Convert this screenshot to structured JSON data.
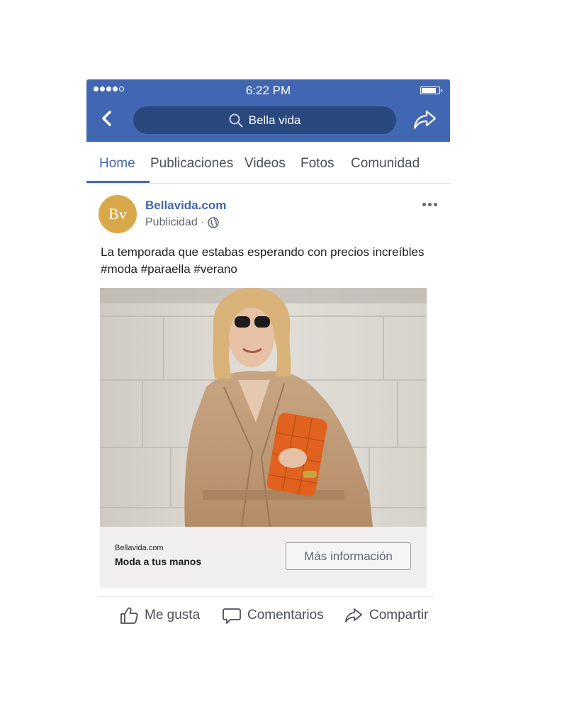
{
  "status_bar": {
    "time": "6:22 PM"
  },
  "nav": {
    "search_text": "Bella vida"
  },
  "tabs": [
    {
      "label": "Home"
    },
    {
      "label": "Publicaciones"
    },
    {
      "label": "Videos"
    },
    {
      "label": "Fotos"
    },
    {
      "label": "Comunidad"
    }
  ],
  "post": {
    "avatar_text": "Bv",
    "page_name": "Bellavida.com",
    "sponsored": "Publicidad ·",
    "text_line1": "La temporada que estabas esperando con precios increíbles",
    "text_line2": "#moda #paraella #verano",
    "link": {
      "domain": "Bellavida.com",
      "headline": "Moda a tus manos",
      "cta": "Más información"
    }
  },
  "actions": {
    "like": "Me gusta",
    "comment": "Comentarios",
    "share": "Compartir"
  },
  "colors": {
    "brand_blue": "#4267b2",
    "search_blue": "#29487d",
    "avatar_gold": "#d9a84a"
  }
}
